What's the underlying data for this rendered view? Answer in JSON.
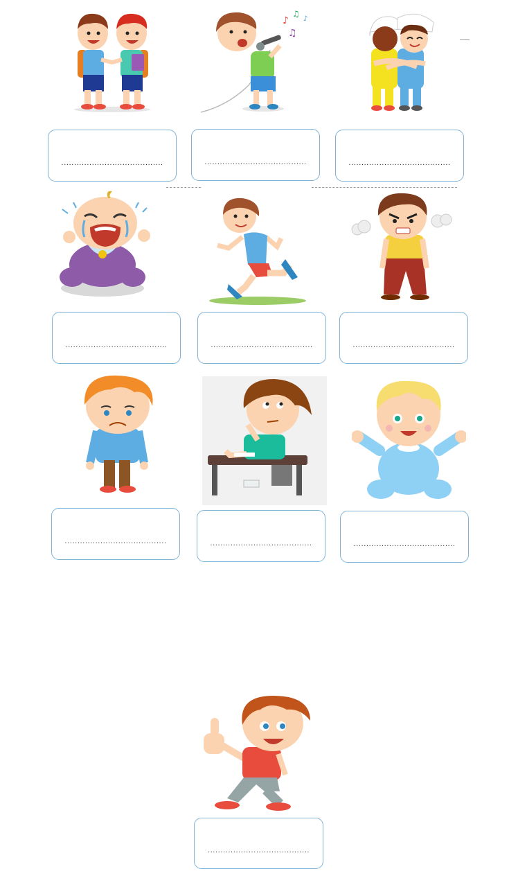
{
  "worksheet": {
    "answer_line": "........................................",
    "cards": [
      {
        "picture": "two-boys-talking-icon",
        "answer": "........................................"
      },
      {
        "picture": "boy-singing-microphone-icon",
        "answer": "........................................"
      },
      {
        "picture": "boys-hugging-icon",
        "answer": "........................................"
      },
      {
        "picture": "baby-crying-icon",
        "answer": "........................................"
      },
      {
        "picture": "boy-running-icon",
        "answer": "........................................"
      },
      {
        "picture": "angry-boy-icon",
        "answer": "........................................"
      },
      {
        "picture": "sad-boy-icon",
        "answer": "........................................"
      },
      {
        "picture": "boy-thinking-at-desk-icon",
        "answer": "........................................"
      },
      {
        "picture": "happy-baby-icon",
        "answer": "........................................"
      },
      {
        "picture": "boy-thumbs-up-icon",
        "answer": "........................................"
      }
    ]
  },
  "colors": {
    "box_border": "#7fb3d5",
    "skin": "#fcd3b0",
    "hair_brown": "#a0522d",
    "hair_orange": "#f28c28"
  }
}
